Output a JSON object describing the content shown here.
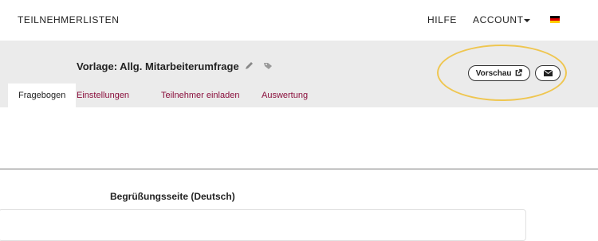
{
  "nav": {
    "brand": "TEILNEHMERLISTEN",
    "help": "HILFE",
    "account": "ACCOUNT",
    "language_icon": "german-flag-icon"
  },
  "header": {
    "title": "Vorlage: Allg. Mitarbeiterumfrage",
    "edit_icon": "pencil-icon",
    "tag_icon": "tag-icon",
    "preview_label": "Vorschau",
    "preview_icon": "external-link-icon",
    "mail_icon": "envelope-icon",
    "highlight_color": "#efc650"
  },
  "tabs": [
    {
      "label": "Fragebogen",
      "active": true
    },
    {
      "label": "Einstellungen",
      "active": false
    },
    {
      "label": "Teilnehmer einladen",
      "active": false
    },
    {
      "label": "Auswertung",
      "active": false
    }
  ],
  "main": {
    "section_title": "Begrüßungsseite (Deutsch)"
  },
  "colors": {
    "tab_link": "#8a0f3c",
    "band_bg": "#ebebeb"
  }
}
